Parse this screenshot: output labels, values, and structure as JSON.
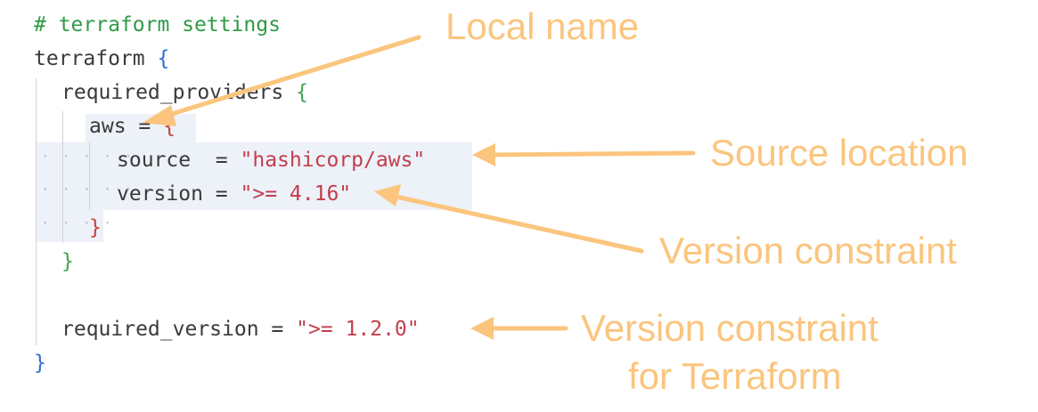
{
  "code": {
    "comment": "# terraform settings",
    "terraform_kw": "terraform",
    "open_brace": "{",
    "close_brace": "}",
    "required_providers": "required_providers",
    "aws_key": "aws",
    "equals": "=",
    "source_key": "source",
    "source_value": "\"hashicorp/aws\"",
    "version_key": "version",
    "version_value": "\">= 4.16\"",
    "required_version_key": "required_version",
    "required_version_value": "\">= 1.2.0\""
  },
  "annotations": {
    "local_name": "Local name",
    "source_location": "Source location",
    "version_constraint": "Version constraint",
    "version_constraint_tf_line1": "Version constraint",
    "version_constraint_tf_line2": "for Terraform"
  },
  "colors": {
    "annotation": "#fbc57e",
    "comment": "#2f9a46",
    "string": "#c23e4d",
    "brace_outer": "#2c6fd6",
    "brace_mid": "#45a353",
    "brace_inner": "#c6423a"
  }
}
